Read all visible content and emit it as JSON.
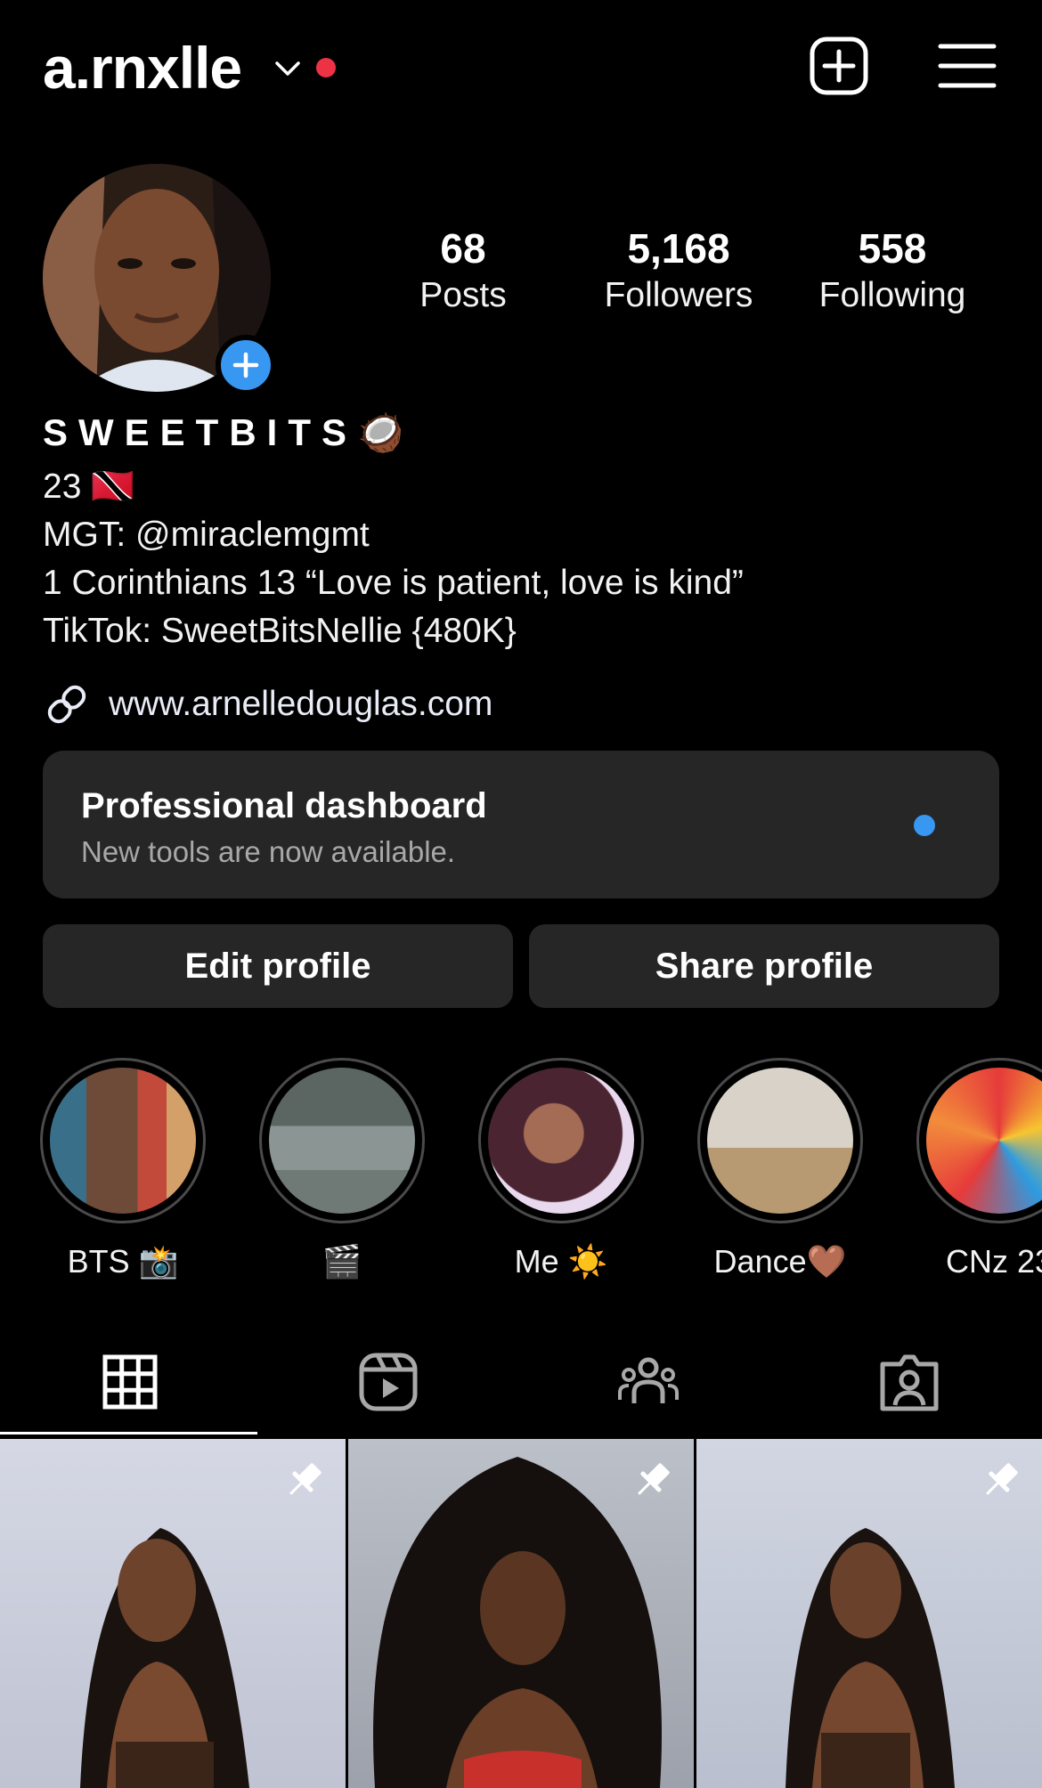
{
  "header": {
    "username": "a.rnxlle",
    "icons": [
      "chevron-down-icon",
      "notification-dot",
      "new-post-icon",
      "menu-icon"
    ]
  },
  "profile": {
    "stats": [
      {
        "value": "68",
        "label": "Posts"
      },
      {
        "value": "5,168",
        "label": "Followers"
      },
      {
        "value": "558",
        "label": "Following"
      }
    ],
    "display_name": "SWEETBITS🥥",
    "bio_lines": [
      "23 🇹🇹",
      "MGT: @miraclemgmt",
      "1 Corinthians 13 “Love is patient, love is kind”",
      "TikTok: SweetBitsNellie {480K}"
    ],
    "link": "www.arnelledouglas.com"
  },
  "dashboard": {
    "title": "Professional dashboard",
    "subtitle": "New tools are now available."
  },
  "buttons": {
    "edit": "Edit profile",
    "share": "Share profile"
  },
  "highlights": [
    {
      "label": "BTS 📸"
    },
    {
      "label": "🎬"
    },
    {
      "label": "Me ☀️"
    },
    {
      "label": "Dance🤎"
    },
    {
      "label": "CNz 23"
    }
  ],
  "tabs": [
    "grid-icon",
    "reels-icon",
    "collab-icon",
    "tagged-icon"
  ],
  "colors": {
    "accent": "#3897f0",
    "notification": "#ee3245",
    "card": "#262626"
  }
}
